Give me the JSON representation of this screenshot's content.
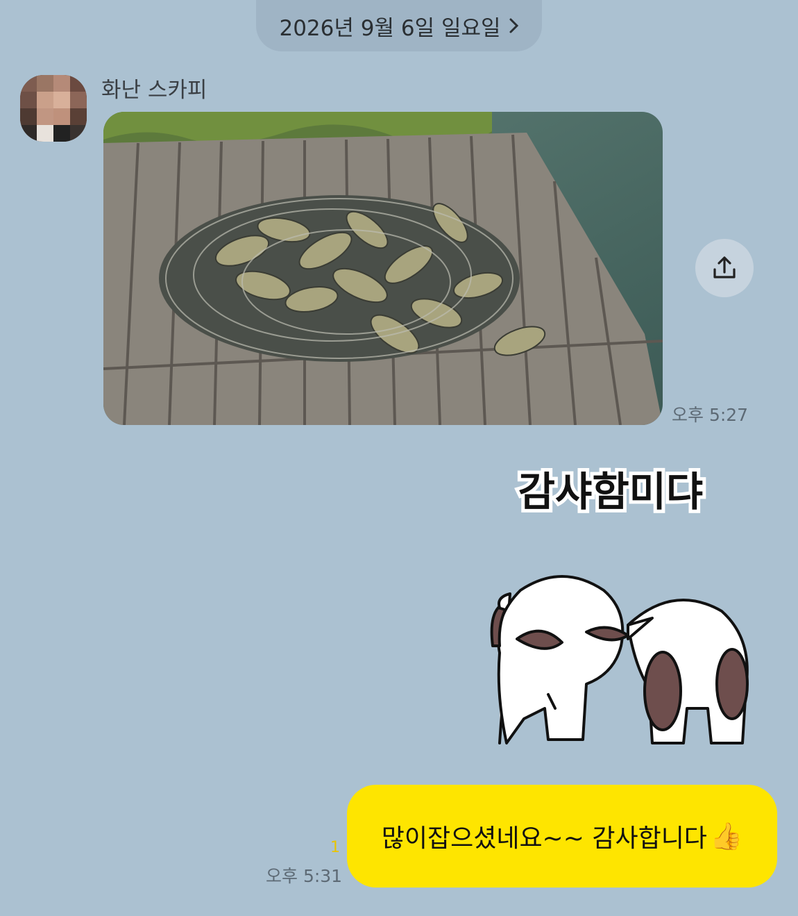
{
  "date_separator": {
    "label": "2026년 9월 6일 일요일",
    "chevron_icon": "chevron-right-icon"
  },
  "incoming": {
    "sender_name": "화난 스카피",
    "avatar_icon": "pixelated-avatar-icon",
    "photo_icon": "fish-catch-photo",
    "share_icon": "share-upload-icon",
    "time": "오후 5:27"
  },
  "outgoing": {
    "sticker_text_icon": "thanks-text-sticker",
    "sticker_text": "감샤함미댜",
    "sticker_character_icon": "bowing-characters-sticker",
    "message": "많이잡으셨네요~~ 감사합니다",
    "emoji": "👍",
    "unread_count": "1",
    "time": "오후 5:31",
    "bubble_color": "#fee500"
  }
}
